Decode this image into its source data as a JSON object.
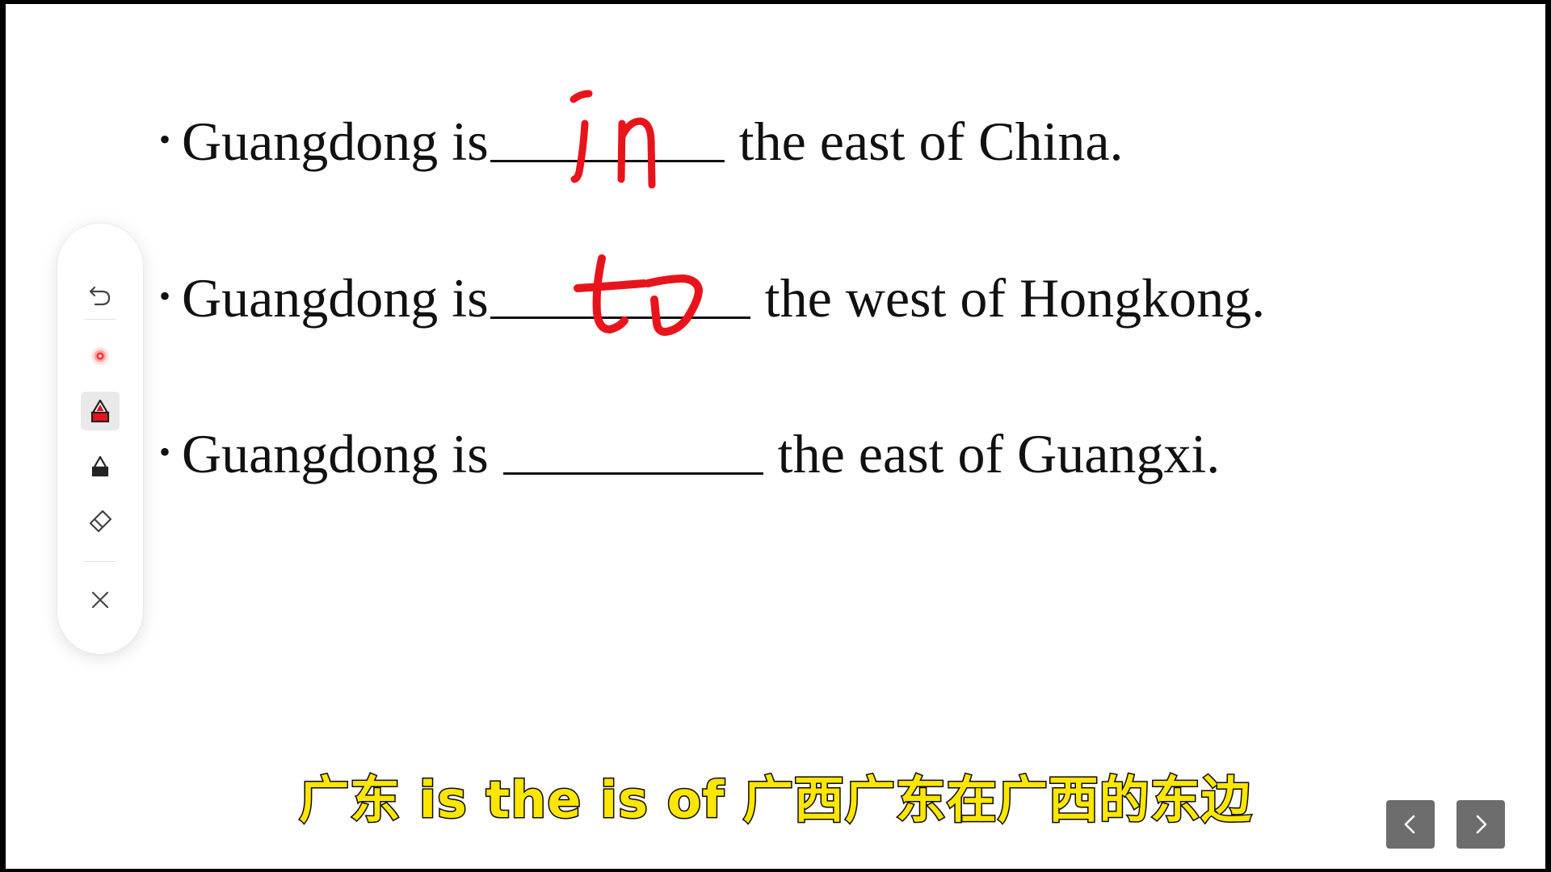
{
  "slide": {
    "sentences": [
      {
        "before": "Guangdong is",
        "after": "the east of China.",
        "answer": "in"
      },
      {
        "before": "Guangdong is",
        "after": "the west of Hongkong.",
        "answer": "to"
      },
      {
        "before": "Guangdong is",
        "after": "the east of Guangxi.",
        "answer": ""
      }
    ],
    "bullet": "•"
  },
  "toolbar": {
    "tools": [
      {
        "name": "undo-icon"
      },
      {
        "name": "laser-pointer-icon"
      },
      {
        "name": "red-marker-icon",
        "active": true
      },
      {
        "name": "black-marker-icon"
      },
      {
        "name": "eraser-icon"
      },
      {
        "name": "close-icon"
      }
    ]
  },
  "subtitle": {
    "text": "广东 is the is of 广西广东在广西的东边"
  },
  "navigation": {
    "prev_icon": "chevron-left-icon",
    "next_icon": "chevron-right-icon"
  },
  "colors": {
    "ink": "#e8141c",
    "subtitle": "#ffe600",
    "nav_button": "#6d6d6d"
  }
}
